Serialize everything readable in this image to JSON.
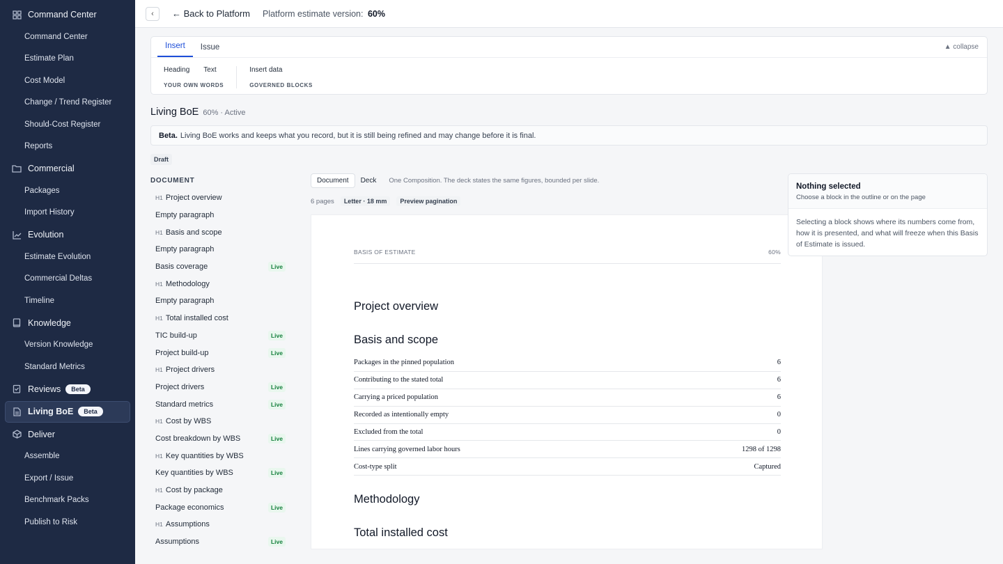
{
  "sidebar": {
    "groups": [
      {
        "label": "Command Center",
        "icon": "grid-icon",
        "items": [
          "Command Center",
          "Estimate Plan",
          "Cost Model",
          "Change / Trend Register",
          "Should-Cost Register",
          "Reports"
        ]
      },
      {
        "label": "Commercial",
        "icon": "folder-icon",
        "items": [
          "Packages",
          "Import History"
        ]
      },
      {
        "label": "Evolution",
        "icon": "chart-line-icon",
        "items": [
          "Estimate Evolution",
          "Commercial Deltas",
          "Timeline"
        ]
      },
      {
        "label": "Knowledge",
        "icon": "book-icon",
        "items": [
          "Version Knowledge",
          "Standard Metrics"
        ]
      }
    ],
    "reviews": {
      "label": "Reviews",
      "badge": "Beta"
    },
    "living_boe": {
      "label": "Living BoE",
      "badge": "Beta"
    },
    "deliver": {
      "label": "Deliver",
      "items": [
        "Assemble",
        "Export / Issue",
        "Benchmark Packs",
        "Publish to Risk"
      ]
    }
  },
  "topbar": {
    "back_chevron": "‹",
    "back_label": "← Back to Platform",
    "version_label": "Platform estimate version:",
    "version_value": "60%"
  },
  "insert_panel": {
    "tabs": [
      "Insert",
      "Issue"
    ],
    "collapse_label": "▲ collapse",
    "own_words": {
      "actions": [
        "Heading",
        "Text"
      ],
      "caption": "YOUR OWN WORDS"
    },
    "governed": {
      "actions": [
        "Insert data"
      ],
      "caption": "GOVERNED BLOCKS"
    }
  },
  "boe": {
    "title": "Living BoE",
    "meta": "60% · Active",
    "beta_strong": "Beta.",
    "beta_text": "Living BoE works and keeps what you record, but it is still being refined and may change before it is final.",
    "draft": "Draft"
  },
  "outline": {
    "heading": "DOCUMENT",
    "h1_marker": "H1",
    "live_label": "Live",
    "items": [
      {
        "label": "Project overview",
        "h1": true,
        "live": false
      },
      {
        "label": "Empty paragraph",
        "h1": false,
        "live": false
      },
      {
        "label": "Basis and scope",
        "h1": true,
        "live": false
      },
      {
        "label": "Empty paragraph",
        "h1": false,
        "live": false
      },
      {
        "label": "Basis coverage",
        "h1": false,
        "live": true
      },
      {
        "label": "Methodology",
        "h1": true,
        "live": false
      },
      {
        "label": "Empty paragraph",
        "h1": false,
        "live": false
      },
      {
        "label": "Total installed cost",
        "h1": true,
        "live": false
      },
      {
        "label": "TIC build-up",
        "h1": false,
        "live": true
      },
      {
        "label": "Project build-up",
        "h1": false,
        "live": true
      },
      {
        "label": "Project drivers",
        "h1": true,
        "live": false
      },
      {
        "label": "Project drivers",
        "h1": false,
        "live": true
      },
      {
        "label": "Standard metrics",
        "h1": false,
        "live": true
      },
      {
        "label": "Cost by WBS",
        "h1": true,
        "live": false
      },
      {
        "label": "Cost breakdown by WBS",
        "h1": false,
        "live": true
      },
      {
        "label": "Key quantities by WBS",
        "h1": true,
        "live": false
      },
      {
        "label": "Key quantities by WBS",
        "h1": false,
        "live": true
      },
      {
        "label": "Cost by package",
        "h1": true,
        "live": false
      },
      {
        "label": "Package economics",
        "h1": false,
        "live": true
      },
      {
        "label": "Assumptions",
        "h1": true,
        "live": false
      },
      {
        "label": "Assumptions",
        "h1": false,
        "live": true
      }
    ]
  },
  "doc_toolbar": {
    "modes": [
      "Document",
      "Deck"
    ],
    "note": "One Composition. The deck states the same figures, bounded per slide.",
    "pages": "6 pages",
    "page_format": "Letter · 18 mm",
    "preview": "Preview pagination"
  },
  "page": {
    "header_left": "BASIS OF ESTIMATE",
    "header_right": "60%",
    "h_overview": "Project overview",
    "h_basis": "Basis and scope",
    "h_method": "Methodology",
    "h_tic": "Total installed cost",
    "basis_rows": [
      {
        "label": "Packages in the pinned population",
        "value": "6"
      },
      {
        "label": "Contributing to the stated total",
        "value": "6"
      },
      {
        "label": "Carrying a priced population",
        "value": "6"
      },
      {
        "label": "Recorded as intentionally empty",
        "value": "0"
      },
      {
        "label": "Excluded from the total",
        "value": "0"
      },
      {
        "label": "Lines carrying governed labor hours",
        "value": "1298 of 1298"
      },
      {
        "label": "Cost-type split",
        "value": "Captured"
      }
    ]
  },
  "inspector": {
    "title": "Nothing selected",
    "subtitle": "Choose a block in the outline or on the page",
    "body": "Selecting a block shows where its numbers come from, how it is presented, and what will freeze when this Basis of Estimate is issued."
  }
}
